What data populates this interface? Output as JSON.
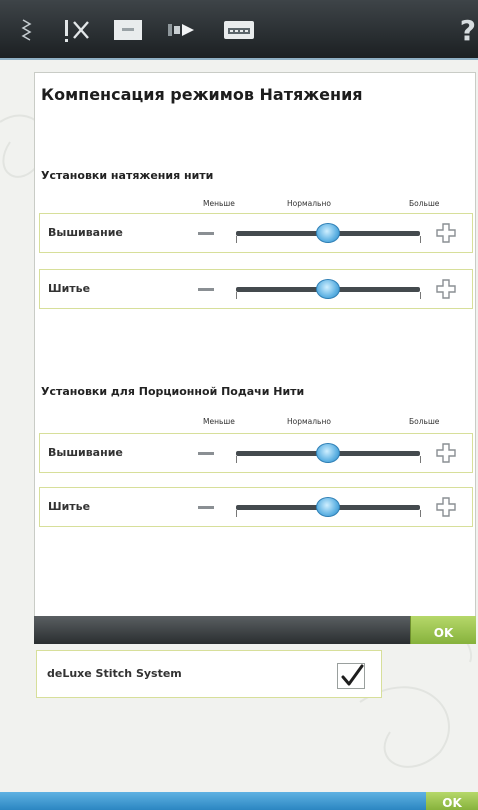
{
  "toolbar": {
    "icons": [
      "drag-handle-icon",
      "thread-icon",
      "display-icon",
      "needle-arrow-icon",
      "keyboard-icon"
    ],
    "help_label": "?"
  },
  "panel": {
    "title": "Компенсация режимов Натяжения",
    "sections": [
      {
        "title": "Установки натяжения нити",
        "scale": {
          "low": "Меньше",
          "mid": "Нормально",
          "high": "Больше"
        },
        "sliders": [
          {
            "label": "Вышивание",
            "value_fraction": 0.5
          },
          {
            "label": "Шитье",
            "value_fraction": 0.5
          }
        ]
      },
      {
        "title": "Установки для Порционной Подачи Нити",
        "scale": {
          "low": "Меньше",
          "mid": "Нормально",
          "high": "Больше"
        },
        "sliders": [
          {
            "label": "Вышивание",
            "value_fraction": 0.5
          },
          {
            "label": "Шитье",
            "value_fraction": 0.5
          }
        ]
      }
    ],
    "ok_label": "OK"
  },
  "deluxe": {
    "label": "deLuxe Stitch System",
    "checked": true
  },
  "footer": {
    "ok_label": "OK"
  },
  "colors": {
    "accent_green": "#9cc64f",
    "accent_blue": "#3f9bd3",
    "box_border": "#d7df9a"
  }
}
